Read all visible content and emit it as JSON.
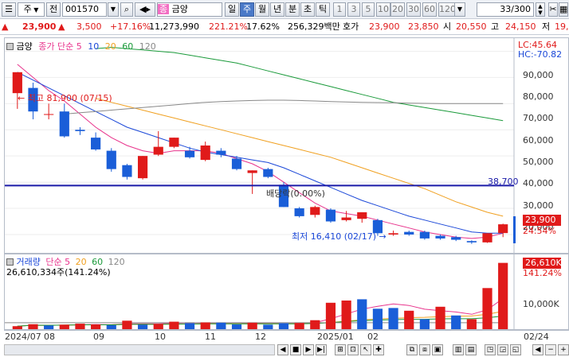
{
  "toolbar": {
    "market_label": "주",
    "jeon_label": "전",
    "code_value": "001570",
    "highlight_tag": "종",
    "stock_name": "금양",
    "period_tabs": [
      "일",
      "주",
      "월",
      "년",
      "분",
      "초",
      "틱"
    ],
    "active_period": "주",
    "interval_buttons": [
      "1",
      "3",
      "5",
      "10",
      "20",
      "30",
      "60",
      "120"
    ],
    "page_count": "33/300"
  },
  "quote": {
    "price": "23,900",
    "change": "3,500",
    "change_pct": "+17.16%",
    "volume": "11,273,990",
    "volume_ratio": "221.21%",
    "turnover_pct": "17.62%",
    "amount": "256,329백만",
    "hoga_label": "호가",
    "ask": "23,900",
    "bid": "23,850",
    "open_label": "시",
    "open": "20,550",
    "high_label": "고",
    "high": "24,150",
    "low_label": "저",
    "low": "19,"
  },
  "price_panel": {
    "legend_name": "금양",
    "legend_ma_label": "종가 단순",
    "ma_periods": [
      "5",
      "10",
      "20",
      "60",
      "120"
    ],
    "lc": "LC:45.64",
    "hc": "HC:-70.82",
    "hline_value": "38,700",
    "current_box": "23,900",
    "current_pct": "24.54%",
    "annotation_high": "최고 81,900 (07/15)",
    "annotation_low": "최저 16,410 (02/17)",
    "annotation_dividend": "배당락(0.00%)",
    "y_ticks": [
      "90,000",
      "80,000",
      "70,000",
      "60,000",
      "50,000",
      "40,000",
      "30,000",
      "20,000"
    ]
  },
  "volume_panel": {
    "legend_name": "거래량",
    "legend_ma_label": "단순",
    "ma_periods": [
      "5",
      "20",
      "60",
      "120"
    ],
    "volume_text": "26,610,334주(141.24%)",
    "current_box": "26,610K",
    "current_pct": "141.24%",
    "y_tick": "10,000K"
  },
  "x_axis": {
    "labels": [
      "2024/07",
      "08",
      "09",
      "10",
      "11",
      "12",
      "2025/01",
      "02"
    ],
    "right_date": "02/24"
  },
  "colors": {
    "up": "#e01a1a",
    "down": "#1a5ed8",
    "hline": "#1a1aa8"
  },
  "chart_data": [
    {
      "type": "candlestick",
      "title": "금양",
      "x_unit": "week",
      "y_range": [
        13000,
        95000
      ],
      "candles": [
        {
          "o": 74000,
          "h": 81900,
          "l": 68000,
          "c": 82000
        },
        {
          "o": 76000,
          "h": 78000,
          "l": 64000,
          "c": 67000
        },
        {
          "o": 66000,
          "h": 70000,
          "l": 64000,
          "c": 66000
        },
        {
          "o": 67000,
          "h": 70000,
          "l": 57000,
          "c": 57500
        },
        {
          "o": 60000,
          "h": 61000,
          "l": 58000,
          "c": 59500
        },
        {
          "o": 57000,
          "h": 59000,
          "l": 52000,
          "c": 52500
        },
        {
          "o": 52000,
          "h": 53000,
          "l": 44000,
          "c": 45000
        },
        {
          "o": 46500,
          "h": 47000,
          "l": 41000,
          "c": 42000
        },
        {
          "o": 41500,
          "h": 50000,
          "l": 41000,
          "c": 50000
        },
        {
          "o": 50500,
          "h": 59500,
          "l": 50000,
          "c": 53500
        },
        {
          "o": 53500,
          "h": 57000,
          "l": 53000,
          "c": 57000
        },
        {
          "o": 52000,
          "h": 53500,
          "l": 49000,
          "c": 49500
        },
        {
          "o": 48500,
          "h": 55500,
          "l": 48000,
          "c": 54000
        },
        {
          "o": 52000,
          "h": 53000,
          "l": 49500,
          "c": 50500
        },
        {
          "o": 49000,
          "h": 50000,
          "l": 44500,
          "c": 45000
        },
        {
          "o": 43500,
          "h": 44500,
          "l": 35500,
          "c": 44500
        },
        {
          "o": 45000,
          "h": 45500,
          "l": 41500,
          "c": 42000
        },
        {
          "o": 39000,
          "h": 40000,
          "l": 30500,
          "c": 30500
        },
        {
          "o": 30000,
          "h": 30500,
          "l": 26500,
          "c": 27000
        },
        {
          "o": 27500,
          "h": 31000,
          "l": 26500,
          "c": 30500
        },
        {
          "o": 29500,
          "h": 30000,
          "l": 24500,
          "c": 25000
        },
        {
          "o": 25500,
          "h": 29000,
          "l": 25000,
          "c": 26500
        },
        {
          "o": 26000,
          "h": 28500,
          "l": 24500,
          "c": 28500
        },
        {
          "o": 25500,
          "h": 26000,
          "l": 19500,
          "c": 20500
        },
        {
          "o": 20000,
          "h": 21500,
          "l": 19500,
          "c": 20500
        },
        {
          "o": 21000,
          "h": 21500,
          "l": 19500,
          "c": 20000
        },
        {
          "o": 21000,
          "h": 21500,
          "l": 18000,
          "c": 18500
        },
        {
          "o": 19500,
          "h": 20000,
          "l": 18000,
          "c": 18500
        },
        {
          "o": 19000,
          "h": 19500,
          "l": 17500,
          "c": 18000
        },
        {
          "o": 17500,
          "h": 17800,
          "l": 16410,
          "c": 17000
        },
        {
          "o": 17000,
          "h": 20500,
          "l": 16800,
          "c": 20500
        },
        {
          "o": 20550,
          "h": 24150,
          "l": 19000,
          "c": 23900
        }
      ],
      "ma_lines": {
        "ma5": [
          85000,
          80000,
          75000,
          71000,
          66000,
          61000,
          57000,
          54000,
          52000,
          51000,
          52000,
          52000,
          52000,
          51000,
          49000,
          47000,
          44000,
          40000,
          36000,
          32000,
          29000,
          28000,
          27000,
          25500,
          24000,
          22500,
          21000,
          20000,
          19000,
          18500,
          19000,
          20500
        ],
        "ma10": [
          82000,
          79000,
          76000,
          73000,
          70000,
          67000,
          64000,
          61000,
          59000,
          57000,
          55000,
          53000,
          51500,
          50500,
          49500,
          48500,
          47500,
          45500,
          43000,
          40500,
          38000,
          35500,
          33000,
          31000,
          29000,
          27000,
          25500,
          24000,
          22500,
          21000,
          20500,
          20500
        ],
        "ma20": [
          null,
          null,
          null,
          null,
          null,
          72000,
          70500,
          69000,
          67500,
          66000,
          64500,
          63000,
          61500,
          60000,
          58500,
          57000,
          55500,
          54000,
          52500,
          51000,
          49500,
          47500,
          45500,
          43500,
          41500,
          39500,
          37500,
          35000,
          32500,
          30500,
          28500,
          27000
        ],
        "ma60": [
          null,
          null,
          null,
          null,
          null,
          91000,
          91500,
          91000,
          90500,
          90000,
          89500,
          88500,
          87500,
          86500,
          85500,
          84000,
          82500,
          81000,
          79500,
          78000,
          76500,
          75000,
          73500,
          72000,
          70500,
          69500,
          68500,
          67500,
          66500,
          65500,
          64500,
          63500
        ],
        "ma120": [
          null,
          null,
          null,
          66000,
          66500,
          67000,
          67500,
          68000,
          68500,
          69000,
          69500,
          70000,
          70500,
          70800,
          71000,
          71200,
          71300,
          71300,
          71200,
          71000,
          70800,
          70600,
          70500,
          70400,
          70300,
          70200,
          70100,
          70000,
          70000,
          70000,
          70000,
          70000
        ]
      },
      "hline": 38700,
      "annotations": [
        "최고 81,900 (07/15)",
        "최저 16,410 (02/17)",
        "배당락(0.00%)"
      ]
    },
    {
      "type": "bar",
      "title": "거래량",
      "unit": "K shares",
      "y_range": [
        0,
        30000
      ],
      "values": [
        1200,
        2000,
        1500,
        1800,
        2200,
        1900,
        1600,
        3400,
        1800,
        2100,
        3000,
        2400,
        2700,
        2600,
        1900,
        2600,
        1800,
        2400,
        2500,
        3600,
        10600,
        11500,
        12000,
        8200,
        8500,
        7400,
        4000,
        9000,
        5500,
        4000,
        16500,
        26610
      ],
      "up": [
        true,
        true,
        false,
        true,
        true,
        true,
        false,
        true,
        false,
        true,
        true,
        false,
        true,
        false,
        false,
        true,
        false,
        false,
        true,
        true,
        true,
        true,
        false,
        false,
        false,
        true,
        false,
        true,
        false,
        true,
        true,
        true
      ]
    }
  ]
}
